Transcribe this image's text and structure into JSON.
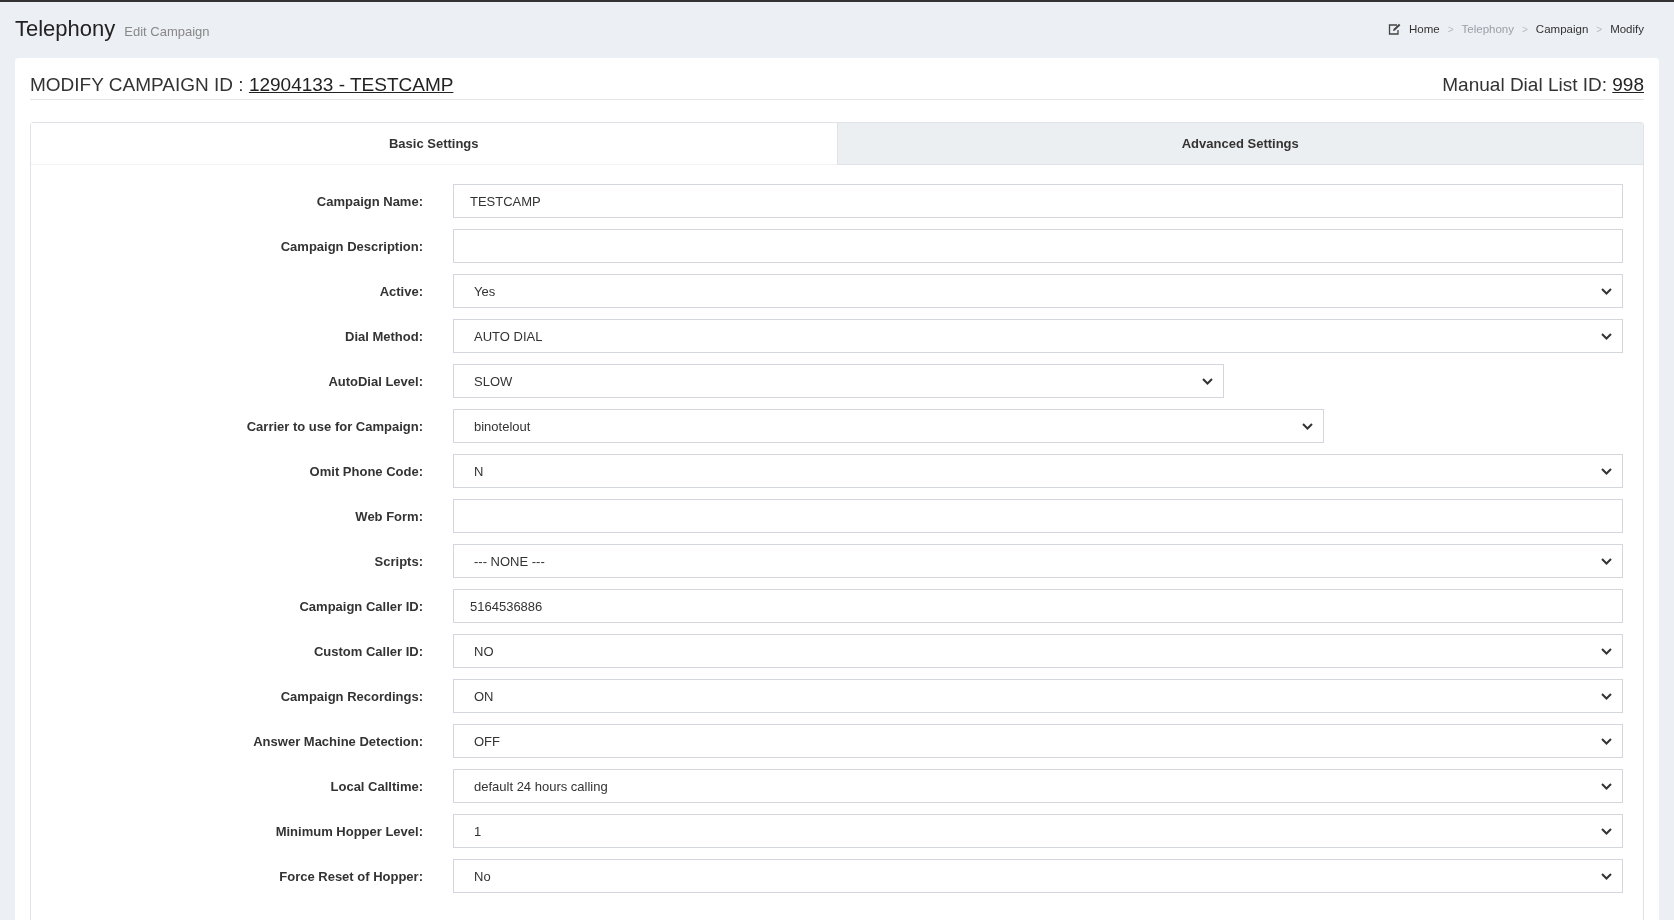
{
  "page": {
    "title": "Telephony",
    "subtitle": "Edit Campaign"
  },
  "breadcrumb": {
    "separator": ">",
    "items": [
      {
        "label": "Home",
        "muted": false
      },
      {
        "label": "Telephony",
        "muted": true
      },
      {
        "label": "Campaign",
        "muted": false
      },
      {
        "label": "Modify",
        "muted": false
      }
    ]
  },
  "heading": {
    "prefix": "MODIFY CAMPAIGN ID : ",
    "link": "12904133 - TESTCAMP",
    "right_prefix": "Manual Dial List ID: ",
    "right_link": "998"
  },
  "tabs": [
    {
      "label": "Basic Settings",
      "selected": true
    },
    {
      "label": "Advanced Settings",
      "selected": false
    }
  ],
  "fields": [
    {
      "label": "Campaign Name:",
      "kind": "text",
      "value": "TESTCAMP"
    },
    {
      "label": "Campaign Description:",
      "kind": "text"
    },
    {
      "label": "Active:",
      "kind": "select",
      "value": "Yes"
    },
    {
      "label": "Dial Method:",
      "kind": "select",
      "value": "AUTO DIAL"
    },
    {
      "label": "AutoDial Level:",
      "kind": "select",
      "value": "SLOW"
    },
    {
      "label": "Carrier to use for Campaign:",
      "kind": "select",
      "value": "binotelout"
    },
    {
      "label": "Omit Phone Code:",
      "kind": "select",
      "value": "N"
    },
    {
      "label": "Web Form:",
      "kind": "text"
    },
    {
      "label": "Scripts:",
      "kind": "select",
      "value": "--- NONE ---"
    },
    {
      "label": "Campaign Caller ID:",
      "kind": "text",
      "value": "5164536886"
    },
    {
      "label": "Custom Caller ID:",
      "kind": "select",
      "value": "NO"
    },
    {
      "label": "Campaign Recordings:",
      "kind": "select",
      "value": "ON"
    },
    {
      "label": "Answer Machine Detection:",
      "kind": "select",
      "value": "OFF"
    },
    {
      "label": "Local Calltime:",
      "kind": "select",
      "value": "default 24 hours calling"
    },
    {
      "label": "Minimum Hopper Level:",
      "kind": "select",
      "value": "1"
    },
    {
      "label": "Force Reset of Hopper:",
      "kind": "select",
      "value": "No"
    }
  ]
}
